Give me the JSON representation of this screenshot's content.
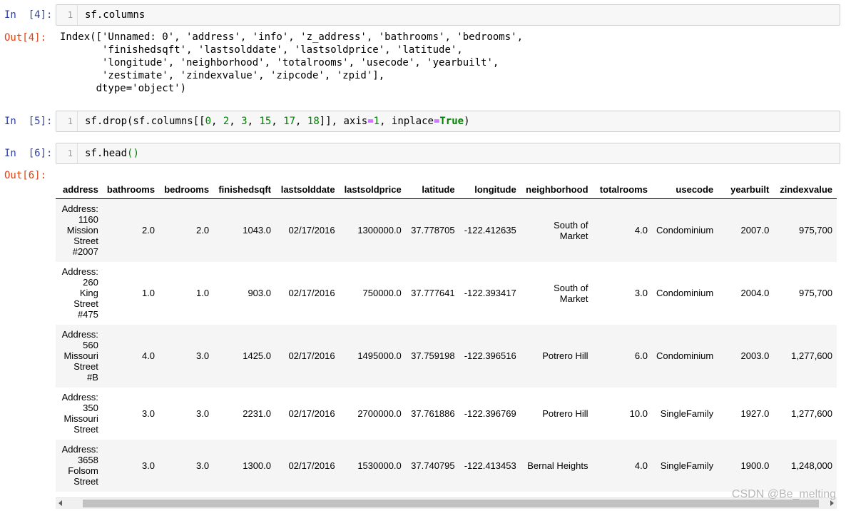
{
  "cells": [
    {
      "in_prompt": "In  [4]:",
      "line_no": "1",
      "code": "sf.columns",
      "out_prompt": "Out[4]:",
      "output_lines": [
        "Index(['Unnamed: 0', 'address', 'info', 'z_address', 'bathrooms', 'bedrooms',",
        "       'finishedsqft', 'lastsolddate', 'lastsoldprice', 'latitude',",
        "       'longitude', 'neighborhood', 'totalrooms', 'usecode', 'yearbuilt',",
        "       'zestimate', 'zindexvalue', 'zipcode', 'zpid'],",
        "      dtype='object')"
      ]
    },
    {
      "in_prompt": "In  [5]:",
      "line_no": "1",
      "code_parts": {
        "a": "sf.drop(sf.columns[[",
        "n0": "0",
        "c1": ", ",
        "n2": "2",
        "c2": ", ",
        "n3": "3",
        "c3": ", ",
        "n15": "15",
        "c4": ", ",
        "n17": "17",
        "c5": ", ",
        "n18": "18",
        "b": "]], axis",
        "eq1": "=",
        "n1": "1",
        "c6": ", inplace",
        "eq2": "=",
        "tru": "True",
        "end": ")"
      }
    },
    {
      "in_prompt": "In  [6]:",
      "line_no": "1",
      "code_a": "sf.head",
      "code_b": "()",
      "out_prompt": "Out[6]:"
    }
  ],
  "dataframe": {
    "columns": [
      "address",
      "bathrooms",
      "bedrooms",
      "finishedsqft",
      "lastsolddate",
      "lastsoldprice",
      "latitude",
      "longitude",
      "neighborhood",
      "totalrooms",
      "usecode",
      "yearbuilt",
      "zindexvalue"
    ],
    "rows": [
      {
        "address": [
          "Address:",
          "1160",
          "Mission",
          "Street",
          "#2007"
        ],
        "cells": [
          "2.0",
          "2.0",
          "1043.0",
          "02/17/2016",
          "1300000.0",
          "37.778705",
          "-122.412635"
        ],
        "neighborhood": [
          "South of",
          "Market"
        ],
        "rest": [
          "4.0",
          "Condominium",
          "2007.0",
          "975,700"
        ]
      },
      {
        "address": [
          "Address:",
          "260",
          "King",
          "Street",
          "#475"
        ],
        "cells": [
          "1.0",
          "1.0",
          "903.0",
          "02/17/2016",
          "750000.0",
          "37.777641",
          "-122.393417"
        ],
        "neighborhood": [
          "South of",
          "Market"
        ],
        "rest": [
          "3.0",
          "Condominium",
          "2004.0",
          "975,700"
        ]
      },
      {
        "address": [
          "Address:",
          "560",
          "Missouri",
          "Street",
          "#B"
        ],
        "cells": [
          "4.0",
          "3.0",
          "1425.0",
          "02/17/2016",
          "1495000.0",
          "37.759198",
          "-122.396516"
        ],
        "neighborhood": [
          "Potrero Hill"
        ],
        "rest": [
          "6.0",
          "Condominium",
          "2003.0",
          "1,277,600"
        ]
      },
      {
        "address": [
          "Address:",
          "350",
          "Missouri",
          "Street"
        ],
        "cells": [
          "3.0",
          "3.0",
          "2231.0",
          "02/17/2016",
          "2700000.0",
          "37.761886",
          "-122.396769"
        ],
        "neighborhood": [
          "Potrero Hill"
        ],
        "rest": [
          "10.0",
          "SingleFamily",
          "1927.0",
          "1,277,600"
        ]
      },
      {
        "address": [
          "Address:",
          "3658",
          "Folsom",
          "Street"
        ],
        "cells": [
          "3.0",
          "3.0",
          "1300.0",
          "02/17/2016",
          "1530000.0",
          "37.740795",
          "-122.413453"
        ],
        "neighborhood": [
          "Bernal Heights"
        ],
        "rest": [
          "4.0",
          "SingleFamily",
          "1900.0",
          "1,248,000"
        ]
      }
    ]
  },
  "watermark": "CSDN @Be_melting",
  "colors": {
    "in_prompt": "#303f9f",
    "out_prompt": "#d84315",
    "keyword": "#008000",
    "cell_bg": "#f7f7f7",
    "row_stripe": "#f5f5f5"
  }
}
